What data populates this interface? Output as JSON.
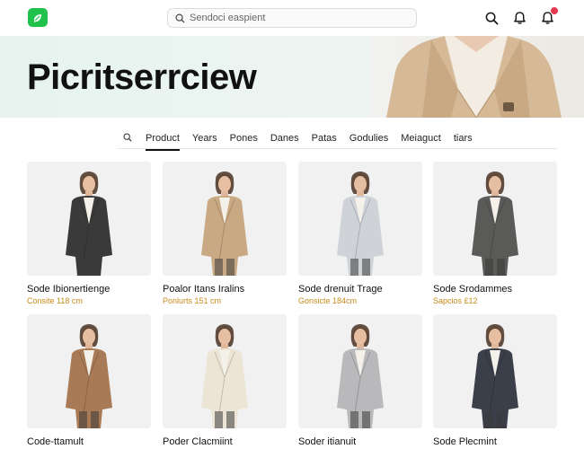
{
  "header": {
    "search_placeholder": "Sendoci easpient",
    "icons": [
      "search-icon",
      "bell-icon",
      "notification-bell-icon"
    ]
  },
  "hero": {
    "title": "Picritserrciew"
  },
  "tabs": [
    {
      "label": "Product",
      "active": true
    },
    {
      "label": "Years",
      "active": false
    },
    {
      "label": "Pones",
      "active": false
    },
    {
      "label": "Danes",
      "active": false
    },
    {
      "label": "Patas",
      "active": false
    },
    {
      "label": "Godulies",
      "active": false
    },
    {
      "label": "Meiaguct",
      "active": false
    },
    {
      "label": "tiars",
      "active": false
    }
  ],
  "products": [
    {
      "name": "Sode Ibionertienge",
      "price": "Consite 118 cm",
      "coat_color": "#3a3a3a"
    },
    {
      "name": "Poalor Itans Iralins",
      "price": "Ponlurts 151 cm",
      "coat_color": "#c9a983"
    },
    {
      "name": "Sode drenuit Trage",
      "price": "Gonsicte 184cm",
      "coat_color": "#cfd3d8"
    },
    {
      "name": "Sode Srodammes",
      "price": "Sapcios £12",
      "coat_color": "#5a5a58"
    },
    {
      "name": "Code-ttamult",
      "price": "",
      "coat_color": "#a87a55"
    },
    {
      "name": "Poder Clacmiint",
      "price": "",
      "coat_color": "#ece5d6"
    },
    {
      "name": "Soder itianuit",
      "price": "",
      "coat_color": "#b9b9bb"
    },
    {
      "name": "Sode Plecmint",
      "price": "",
      "coat_color": "#3b3f4a"
    }
  ],
  "colors": {
    "brand": "#21c24b",
    "badge": "#e53950",
    "price": "#c98a1b"
  }
}
